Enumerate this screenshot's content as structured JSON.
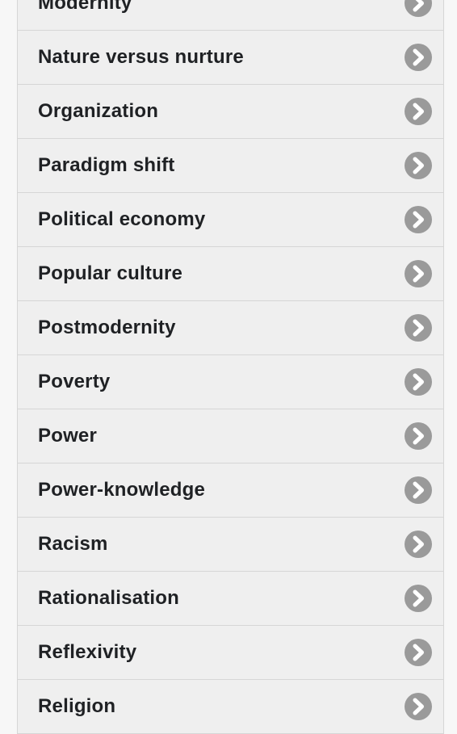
{
  "list": {
    "items": [
      {
        "label": "Modernity",
        "icon": "chevron-right-circle-icon"
      },
      {
        "label": "Nature versus nurture",
        "icon": "chevron-right-circle-icon"
      },
      {
        "label": "Organization",
        "icon": "chevron-right-circle-icon"
      },
      {
        "label": "Paradigm shift",
        "icon": "chevron-right-circle-icon"
      },
      {
        "label": "Political economy",
        "icon": "chevron-right-circle-icon"
      },
      {
        "label": "Popular culture",
        "icon": "chevron-right-circle-icon"
      },
      {
        "label": "Postmodernity",
        "icon": "chevron-right-circle-icon"
      },
      {
        "label": "Poverty",
        "icon": "chevron-right-circle-icon"
      },
      {
        "label": "Power",
        "icon": "chevron-right-circle-icon"
      },
      {
        "label": "Power-knowledge",
        "icon": "chevron-right-circle-icon"
      },
      {
        "label": "Racism",
        "icon": "chevron-right-circle-icon"
      },
      {
        "label": "Rationalisation",
        "icon": "chevron-right-circle-icon"
      },
      {
        "label": "Reflexivity",
        "icon": "chevron-right-circle-icon"
      },
      {
        "label": "Religion",
        "icon": "chevron-right-circle-icon"
      }
    ]
  },
  "colors": {
    "item_background": "#efefef",
    "text": "#1f2124",
    "chevron": "#9a9a9a",
    "divider": "#d6d6d6"
  }
}
